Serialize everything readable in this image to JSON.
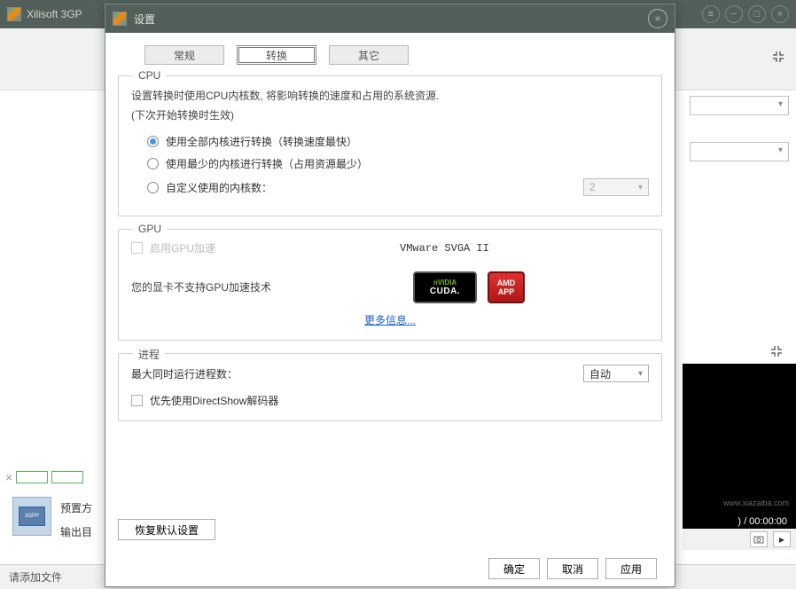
{
  "main_window": {
    "title": "Xilisoft 3GP",
    "preset_label": "预置方",
    "output_label": "输出目",
    "status_text": "请添加文件",
    "video_time": ") / 00:00:00",
    "watermark": "www.xiazaiba.com"
  },
  "dialog": {
    "title": "设置",
    "tabs": {
      "general": "常规",
      "convert": "转换",
      "other": "其它"
    },
    "cpu": {
      "legend": "CPU",
      "desc_line1": "设置转换时使用CPU内核数, 将影响转换的速度和占用的系统资源.",
      "desc_line2": "(下次开始转换时生效)",
      "opt_all": "使用全部内核进行转换（转换速度最快）",
      "opt_min": "使用最少的内核进行转换（占用资源最少）",
      "opt_custom": "自定义使用的内核数：",
      "core_value": "2"
    },
    "gpu": {
      "legend": "GPU",
      "enable_label": "启用GPU加速",
      "device_name": "VMware SVGA II",
      "unsupported": "您的显卡不支持GPU加速技术",
      "nvidia_top": "nVIDIA",
      "nvidia_bottom": "CUDA.",
      "amd_top": "AMD",
      "amd_bottom": "APP",
      "more_info": "更多信息..."
    },
    "process": {
      "legend": "进程",
      "max_label": "最大同时运行进程数：",
      "max_value": "自动",
      "dshow_label": "优先使用DirectShow解码器"
    },
    "buttons": {
      "restore": "恢复默认设置",
      "ok": "确定",
      "cancel": "取消",
      "apply": "应用"
    }
  }
}
